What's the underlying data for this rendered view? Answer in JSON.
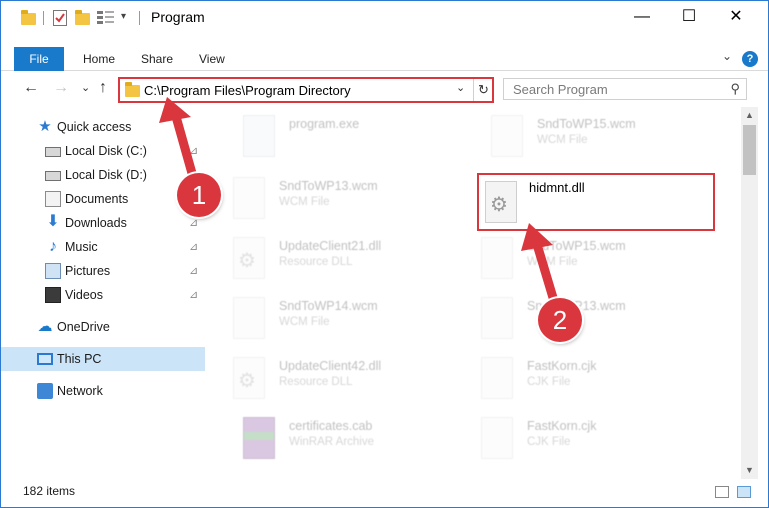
{
  "window": {
    "title": "Program"
  },
  "quick_access_toolbar": {
    "items": [
      "folder-icon",
      "properties-icon",
      "new-folder-icon",
      "customize-icon"
    ]
  },
  "window_controls": {
    "minimize": "—",
    "maximize": "☐",
    "close": "✕"
  },
  "ribbon": {
    "tabs": [
      {
        "label": "File"
      },
      {
        "label": "Home"
      },
      {
        "label": "Share"
      },
      {
        "label": "View"
      }
    ],
    "collapse_glyph": "⌄",
    "help_glyph": "?"
  },
  "navigation": {
    "back": "←",
    "forward": "→",
    "recent": "⌄",
    "up": "↑",
    "address": "C:\\Program Files\\Program Directory",
    "address_dropdown": "⌄",
    "refresh": "↻",
    "search_placeholder": "Search Program",
    "search_icon": "⚲"
  },
  "sidebar": {
    "items": [
      {
        "label": "Quick access",
        "icon": "star-icon",
        "pinned": false
      },
      {
        "label": "Local Disk (C:)",
        "icon": "drive-icon",
        "pinned": true
      },
      {
        "label": "Local Disk (D:)",
        "icon": "drive-icon",
        "pinned": true
      },
      {
        "label": "Documents",
        "icon": "documents-icon",
        "pinned": true
      },
      {
        "label": "Downloads",
        "icon": "download-icon",
        "pinned": true
      },
      {
        "label": "Music",
        "icon": "music-icon",
        "pinned": true
      },
      {
        "label": "Pictures",
        "icon": "pictures-icon",
        "pinned": true
      },
      {
        "label": "Videos",
        "icon": "videos-icon",
        "pinned": true
      },
      {
        "label": "OneDrive",
        "icon": "cloud-icon",
        "pinned": false
      },
      {
        "label": "This PC",
        "icon": "pc-icon",
        "pinned": false,
        "selected": true
      },
      {
        "label": "Network",
        "icon": "network-icon",
        "pinned": false
      }
    ],
    "pin_glyph": "📌"
  },
  "files": [
    {
      "name": "program.exe",
      "type": "",
      "icon": "exe-icon",
      "highlighted": false
    },
    {
      "name": "SndToWP15.wcm",
      "type": "WCM File",
      "icon": "file-icon",
      "highlighted": false
    },
    {
      "name": "SndToWP13.wcm",
      "type": "WCM File",
      "icon": "file-icon",
      "highlighted": false
    },
    {
      "name": "hidmnt.dll",
      "type": "",
      "icon": "dll-icon",
      "highlighted": true
    },
    {
      "name": "UpdateClient21.dll",
      "type": "Resource DLL",
      "icon": "dll-icon",
      "highlighted": false
    },
    {
      "name": "SndToWP15.wcm",
      "type": "WCM File",
      "icon": "file-icon",
      "highlighted": false
    },
    {
      "name": "SndToWP14.wcm",
      "type": "WCM File",
      "icon": "file-icon",
      "highlighted": false
    },
    {
      "name": "SndToWP13.wcm",
      "type": "",
      "icon": "file-icon",
      "highlighted": false
    },
    {
      "name": "UpdateClient42.dll",
      "type": "Resource DLL",
      "icon": "dll-icon",
      "highlighted": false
    },
    {
      "name": "FastKorn.cjk",
      "type": "CJK File",
      "icon": "file-icon",
      "highlighted": false
    },
    {
      "name": "certificates.cab",
      "type": "WinRAR Archive",
      "icon": "cab-icon",
      "highlighted": false
    },
    {
      "name": "FastKorn.cjk",
      "type": "CJK File",
      "icon": "file-icon",
      "highlighted": false
    }
  ],
  "scrollbar": {
    "up": "▲",
    "down": "▼"
  },
  "status": {
    "item_count": "182 items"
  },
  "annotations": [
    {
      "number": "1",
      "target": "address-bar"
    },
    {
      "number": "2",
      "target": "hidmnt.dll"
    }
  ],
  "colors": {
    "accent": "#1979ca",
    "annotation_red": "#d9363e",
    "selection": "#cce4f7"
  }
}
